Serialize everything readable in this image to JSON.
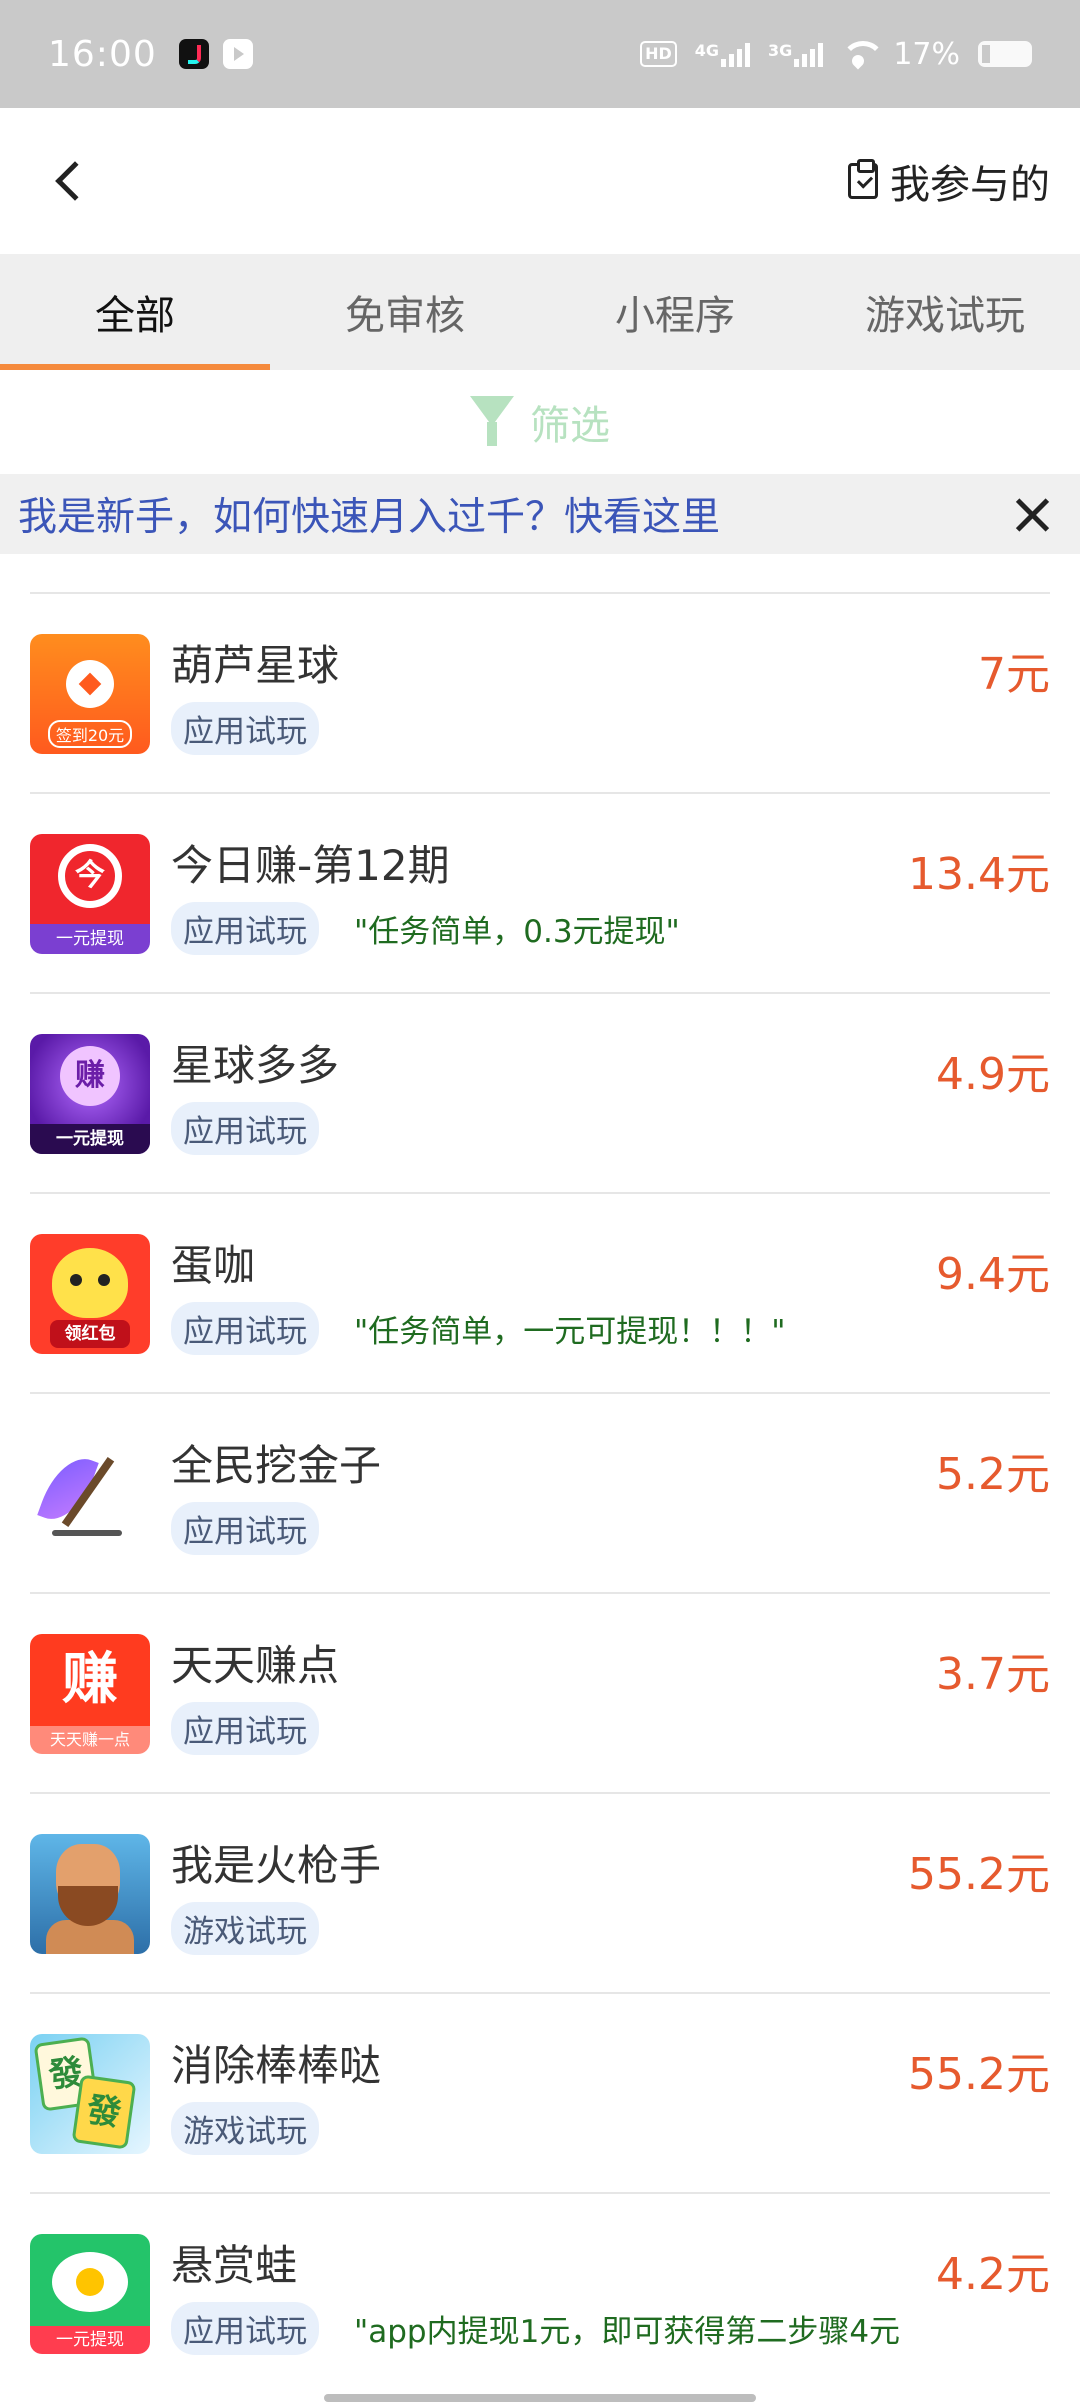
{
  "status_bar": {
    "time": "16:00",
    "network_hd": "HD",
    "signal_1": "4G",
    "signal_2": "3G",
    "battery_percent": "17%"
  },
  "header": {
    "participated_label": "我参与的"
  },
  "tabs": [
    {
      "label": "全部",
      "active": true
    },
    {
      "label": "免审核"
    },
    {
      "label": "小程序"
    },
    {
      "label": "游戏试玩"
    }
  ],
  "filter": {
    "label": "筛选"
  },
  "banner": {
    "text": "我是新手，如何快速月入过千？快看这里"
  },
  "icon_labels": {
    "huluxingqiu": "签到20元",
    "jinrizhuan_glyph": "今",
    "jinrizhuan": "一元提现",
    "xingqiu_glyph": "赚",
    "xingqiu": "一元提现",
    "danka": "领红包",
    "tiantian_glyph": "赚",
    "tiantian": "天天赚一点",
    "mahjong_1": "發",
    "mahjong_2": "發",
    "xuanshangwa": "一元提现"
  },
  "tasks": [
    {
      "name": "葫芦星球",
      "tag": "应用试玩",
      "note": "",
      "reward": "7元",
      "icon": "hulu-xingqiu-icon"
    },
    {
      "name": "今日赚-第12期",
      "tag": "应用试玩",
      "note": "\"任务简单，0.3元提现\"",
      "reward": "13.4元",
      "icon": "jinrizhuan-icon"
    },
    {
      "name": "星球多多",
      "tag": "应用试玩",
      "note": "",
      "reward": "4.9元",
      "icon": "xingqiu-duoduo-icon"
    },
    {
      "name": "蛋咖",
      "tag": "应用试玩",
      "note": "\"任务简单，一元可提现！！！\"",
      "reward": "9.4元",
      "icon": "danka-icon"
    },
    {
      "name": "全民挖金子",
      "tag": "应用试玩",
      "note": "",
      "reward": "5.2元",
      "icon": "quanmin-wajinzi-icon"
    },
    {
      "name": "天天赚点",
      "tag": "应用试玩",
      "note": "",
      "reward": "3.7元",
      "icon": "tiantian-zhuandian-icon"
    },
    {
      "name": "我是火枪手",
      "tag": "游戏试玩",
      "note": "",
      "reward": "55.2元",
      "icon": "huoqiangshou-icon"
    },
    {
      "name": "消除棒棒哒",
      "tag": "游戏试玩",
      "note": "",
      "reward": "55.2元",
      "icon": "xiaochu-bangbangda-icon"
    },
    {
      "name": "悬赏蛙",
      "tag": "应用试玩",
      "note": "\"app内提现1元，即可获得第二步骤4元",
      "reward": "4.2元",
      "icon": "xuanshangwa-icon"
    }
  ],
  "colors": {
    "accent": "#f58a3c",
    "reward": "#e65a2e",
    "banner_text": "#3b55b8",
    "note_text": "#1f6b20"
  }
}
